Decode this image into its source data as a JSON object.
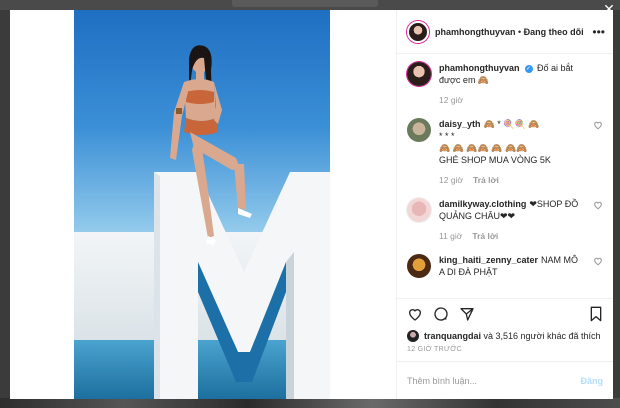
{
  "post_header": {
    "username": "phamhongthuyvan",
    "separator": " • ",
    "follow_status": "Đang theo dõi"
  },
  "caption": {
    "username": "phamhongthuyvan",
    "text": "Đố ai bắt được em 🙈",
    "time": "12 giờ"
  },
  "comments": [
    {
      "username": "daisy_yth",
      "line1": "🙈 * 🍭🍭 🙈",
      "line2": "* * *",
      "line3": "🙈 🙈 🙈🙈 🙈 🙈🙈",
      "line4": "GHÉ SHOP MUA VÒNG 5K",
      "time": "12 giờ",
      "reply": "Trả lời"
    },
    {
      "username": "damilkyway.clothing",
      "text": "❤SHOP ĐỒ QUẢNG CHÂU❤❤",
      "time": "11 giờ",
      "reply": "Trả lời"
    },
    {
      "username": "king_haiti_zenny_cater",
      "text": "NAM MÔ A DI ĐÀ PHẬT"
    }
  ],
  "likes": {
    "user": "tranquangdai",
    "rest": " và 3,516 người khác đã thích"
  },
  "timestamp": "12 GIỜ TRƯỚC",
  "comment_box": {
    "placeholder": "Thêm bình luận...",
    "post_label": "Đăng"
  },
  "colors": {
    "accent_blue": "#3897f0",
    "post_disabled": "#b2dffc",
    "meta_gray": "#999999"
  }
}
